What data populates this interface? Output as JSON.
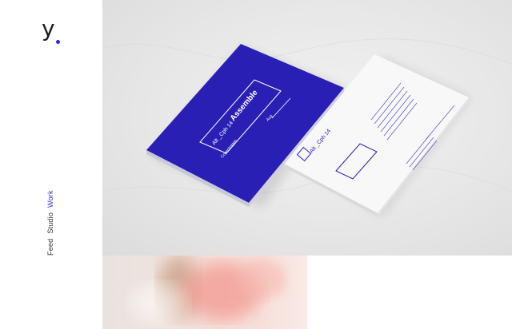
{
  "logo": {
    "letter": "y"
  },
  "nav": {
    "items": [
      {
        "label": "Feed",
        "active": false
      },
      {
        "label": "Studio",
        "active": false
      },
      {
        "label": "Work",
        "active": true
      }
    ]
  },
  "card_front": {
    "title": "Alt _Cph 14",
    "headline": "Assemble",
    "subtext_line1": "Copenhagen",
    "subtext_line2": "Aug"
  },
  "card_back": {
    "brand": "Alt _Cph 14"
  },
  "colors": {
    "accent": "#2b2be0",
    "card_blue": "#2a1fb5"
  }
}
